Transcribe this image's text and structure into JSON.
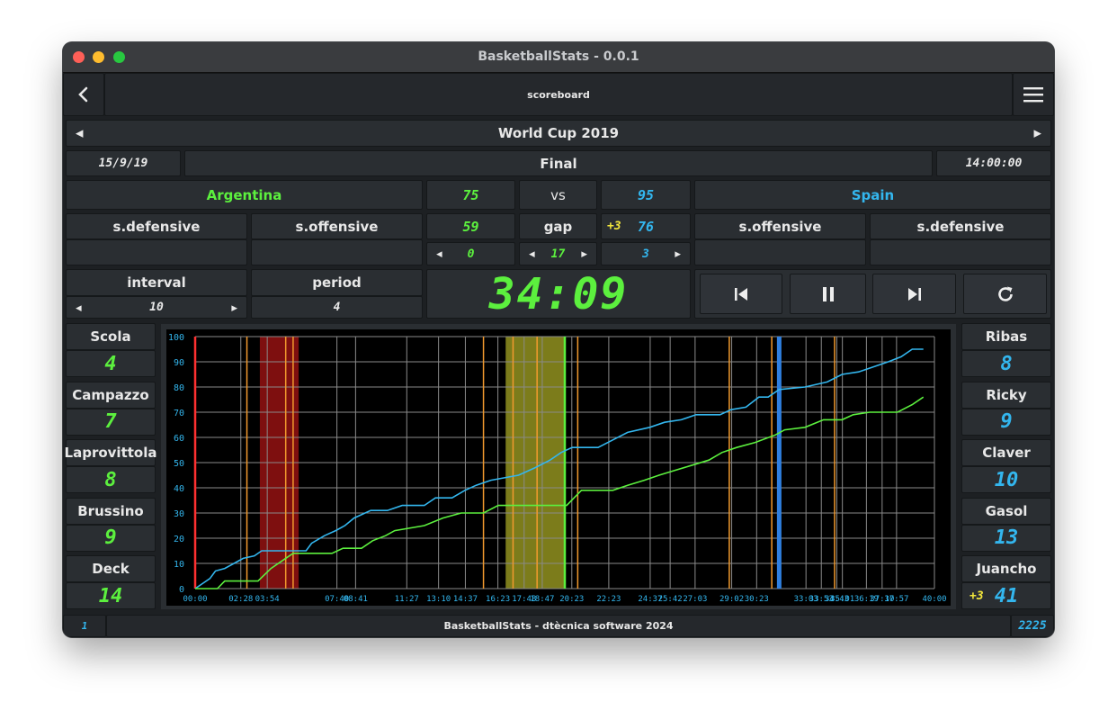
{
  "window": {
    "title": "BasketballStats - 0.0.1"
  },
  "toolbar": {
    "back_icon": "chevron-left-icon",
    "title": "scoreboard",
    "menu_icon": "hamburger-menu-icon"
  },
  "competition": {
    "name": "World Cup 2019",
    "date": "15/9/19",
    "round": "Final",
    "time": "14:00:00"
  },
  "home": {
    "name": "Argentina",
    "score": "75",
    "stat_value": "59",
    "stepper_value": "0",
    "labels": {
      "defensive": "s.defensive",
      "offensive": "s.offensive"
    },
    "color": "#5cf03e"
  },
  "away": {
    "name": "Spain",
    "score": "95",
    "stat_value": "76",
    "bonus": "+3",
    "stepper_value": "3",
    "labels": {
      "offensive": "s.offensive",
      "defensive": "s.defensive"
    },
    "color": "#33b6ee"
  },
  "middle": {
    "vs": "vs",
    "gap_label": "gap",
    "gap_value": "17"
  },
  "interval": {
    "label": "interval",
    "value": "10"
  },
  "period": {
    "label": "period",
    "value": "4"
  },
  "clock": {
    "value": "34:09"
  },
  "controls": {
    "prev_icon": "skip-previous-icon",
    "pause_icon": "pause-icon",
    "next_icon": "skip-next-icon",
    "reset_icon": "refresh-icon"
  },
  "home_players": [
    {
      "name": "Scola",
      "number": "4"
    },
    {
      "name": "Campazzo",
      "number": "7"
    },
    {
      "name": "Laprovittola",
      "number": "8"
    },
    {
      "name": "Brussino",
      "number": "9"
    },
    {
      "name": "Deck",
      "number": "14"
    }
  ],
  "away_players": [
    {
      "name": "Ribas",
      "number": "8",
      "bonus": ""
    },
    {
      "name": "Ricky",
      "number": "9",
      "bonus": ""
    },
    {
      "name": "Claver",
      "number": "10",
      "bonus": ""
    },
    {
      "name": "Gasol",
      "number": "13",
      "bonus": ""
    },
    {
      "name": "Juancho",
      "number": "41",
      "bonus": "+3"
    }
  ],
  "status": {
    "left": "1",
    "center": "BasketballStats - dtècnica software 2024",
    "right": "2225"
  },
  "chart_data": {
    "type": "line",
    "ylim": [
      0,
      100
    ],
    "yticks": [
      0,
      10,
      20,
      30,
      40,
      50,
      60,
      70,
      80,
      90,
      100
    ],
    "xlim": [
      0,
      40
    ],
    "xtick_labels": [
      {
        "t": 0,
        "label": "00:00"
      },
      {
        "t": 2.47,
        "label": "02:28"
      },
      {
        "t": 3.9,
        "label": "03:54"
      },
      {
        "t": 7.67,
        "label": "07:40"
      },
      {
        "t": 8.68,
        "label": "08:41"
      },
      {
        "t": 11.45,
        "label": "11:27"
      },
      {
        "t": 13.17,
        "label": "13:10"
      },
      {
        "t": 14.62,
        "label": "14:37"
      },
      {
        "t": 16.38,
        "label": "16:23"
      },
      {
        "t": 17.8,
        "label": "17:48"
      },
      {
        "t": 18.78,
        "label": "18:47"
      },
      {
        "t": 20.38,
        "label": "20:23"
      },
      {
        "t": 22.38,
        "label": "22:23"
      },
      {
        "t": 24.62,
        "label": "24:37"
      },
      {
        "t": 25.7,
        "label": "25:42"
      },
      {
        "t": 27.05,
        "label": "27:03"
      },
      {
        "t": 29.03,
        "label": "29:02"
      },
      {
        "t": 30.38,
        "label": "30:23"
      },
      {
        "t": 33.05,
        "label": "33:03"
      },
      {
        "t": 33.88,
        "label": "33:53"
      },
      {
        "t": 34.72,
        "label": "34:43"
      },
      {
        "t": 35.02,
        "label": "35:01"
      },
      {
        "t": 36.32,
        "label": "36:19"
      },
      {
        "t": 37.17,
        "label": "37:10"
      },
      {
        "t": 37.95,
        "label": "37:57"
      },
      {
        "t": 40,
        "label": "40:00"
      }
    ],
    "regions": [
      {
        "from": 3.5,
        "to": 5.6,
        "color": "#8c1111"
      },
      {
        "from": 16.8,
        "to": 20.0,
        "color": "#8a8a1e"
      }
    ],
    "orange_markers": [
      2.8,
      4.9,
      5.3,
      15.6,
      17.2,
      18.5,
      20.7,
      28.9,
      31.2,
      34.6
    ],
    "blue_marker": 31.6,
    "green_marker": 20.0,
    "red_marker": 0,
    "series": [
      {
        "name": "Spain",
        "color": "#33b6ee",
        "points": [
          [
            0,
            0
          ],
          [
            0.8,
            4
          ],
          [
            1.1,
            7
          ],
          [
            1.6,
            8
          ],
          [
            2.1,
            10
          ],
          [
            2.6,
            12
          ],
          [
            3.2,
            13
          ],
          [
            3.6,
            15
          ],
          [
            6.0,
            15
          ],
          [
            6.3,
            18
          ],
          [
            7.0,
            21
          ],
          [
            7.6,
            23
          ],
          [
            8.1,
            25
          ],
          [
            8.6,
            28
          ],
          [
            9.5,
            31
          ],
          [
            10.4,
            31
          ],
          [
            11.2,
            33
          ],
          [
            12.4,
            33
          ],
          [
            13.0,
            36
          ],
          [
            13.9,
            36
          ],
          [
            14.6,
            39
          ],
          [
            15.2,
            41
          ],
          [
            16.0,
            43
          ],
          [
            17.5,
            45
          ],
          [
            18.4,
            48
          ],
          [
            19.2,
            51
          ],
          [
            19.8,
            54
          ],
          [
            20.4,
            56
          ],
          [
            21.8,
            56
          ],
          [
            22.6,
            59
          ],
          [
            23.4,
            62
          ],
          [
            24.6,
            64
          ],
          [
            25.4,
            66
          ],
          [
            26.3,
            67
          ],
          [
            27.1,
            69
          ],
          [
            28.4,
            69
          ],
          [
            29.0,
            71
          ],
          [
            29.8,
            72
          ],
          [
            30.5,
            76
          ],
          [
            31.0,
            76
          ],
          [
            31.6,
            79
          ],
          [
            33.0,
            80
          ],
          [
            34.2,
            82
          ],
          [
            35.0,
            85
          ],
          [
            35.9,
            86
          ],
          [
            36.7,
            88
          ],
          [
            37.5,
            90
          ],
          [
            38.2,
            92
          ],
          [
            38.8,
            95
          ],
          [
            39.4,
            95
          ]
        ]
      },
      {
        "name": "Argentina",
        "color": "#5cf03e",
        "points": [
          [
            0,
            0
          ],
          [
            1.2,
            0
          ],
          [
            1.6,
            3
          ],
          [
            3.4,
            3
          ],
          [
            4.1,
            8
          ],
          [
            4.7,
            11
          ],
          [
            5.3,
            14
          ],
          [
            7.4,
            14
          ],
          [
            8.0,
            16
          ],
          [
            9.0,
            16
          ],
          [
            9.6,
            19
          ],
          [
            10.3,
            21
          ],
          [
            10.8,
            23
          ],
          [
            12.4,
            25
          ],
          [
            13.4,
            28
          ],
          [
            14.4,
            30
          ],
          [
            15.6,
            30
          ],
          [
            16.4,
            33
          ],
          [
            20.1,
            33
          ],
          [
            20.5,
            36
          ],
          [
            20.9,
            39
          ],
          [
            22.6,
            39
          ],
          [
            23.4,
            41
          ],
          [
            24.3,
            43
          ],
          [
            25.1,
            45
          ],
          [
            26.0,
            47
          ],
          [
            26.9,
            49
          ],
          [
            27.8,
            51
          ],
          [
            28.5,
            54
          ],
          [
            29.3,
            56
          ],
          [
            30.3,
            58
          ],
          [
            31.4,
            61
          ],
          [
            31.9,
            63
          ],
          [
            33.0,
            64
          ],
          [
            34.0,
            67
          ],
          [
            35.0,
            67
          ],
          [
            35.6,
            69
          ],
          [
            36.5,
            70
          ],
          [
            38.0,
            70
          ],
          [
            38.8,
            73
          ],
          [
            39.4,
            76
          ]
        ]
      }
    ]
  }
}
